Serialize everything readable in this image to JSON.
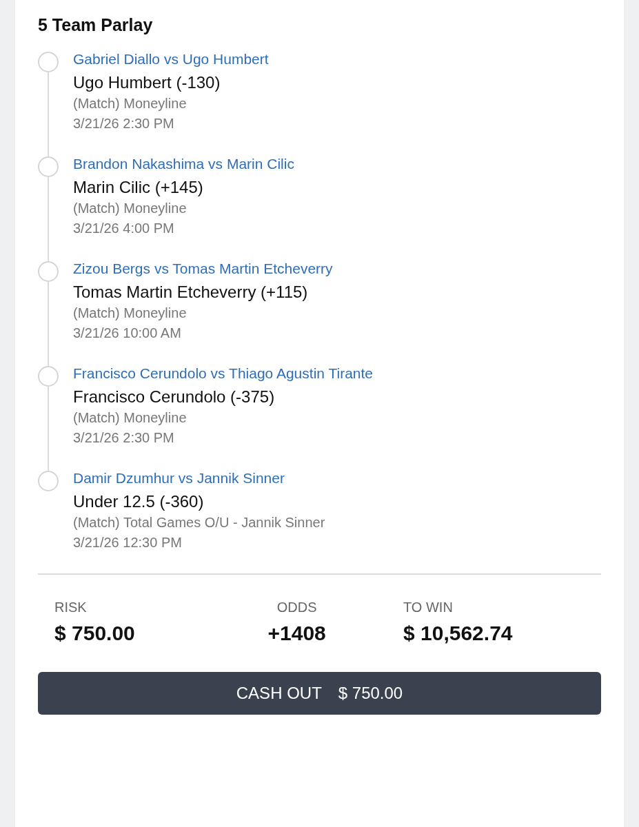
{
  "title": "5 Team Parlay",
  "legs": [
    {
      "matchup": "Gabriel Diallo vs Ugo Humbert",
      "pick": "Ugo Humbert (-130)",
      "market": "(Match) Moneyline",
      "time": "3/21/26 2:30 PM"
    },
    {
      "matchup": "Brandon Nakashima vs Marin Cilic",
      "pick": "Marin Cilic (+145)",
      "market": "(Match) Moneyline",
      "time": "3/21/26 4:00 PM"
    },
    {
      "matchup": "Zizou Bergs vs Tomas Martin Etcheverry",
      "pick": "Tomas Martin Etcheverry (+115)",
      "market": "(Match) Moneyline",
      "time": "3/21/26 10:00 AM"
    },
    {
      "matchup": "Francisco Cerundolo vs Thiago Agustin Tirante",
      "pick": "Francisco Cerundolo (-375)",
      "market": "(Match) Moneyline",
      "time": "3/21/26 2:30 PM"
    },
    {
      "matchup": "Damir Dzumhur vs Jannik Sinner",
      "pick": "Under 12.5 (-360)",
      "market": "(Match) Total Games O/U - Jannik Sinner",
      "time": "3/21/26 12:30 PM"
    }
  ],
  "summary": [
    {
      "label": "RISK",
      "value": "$ 750.00"
    },
    {
      "label": "ODDS",
      "value": "+1408"
    },
    {
      "label": "TO WIN",
      "value": "$ 10,562.74"
    }
  ],
  "cash_out": {
    "label": "CASH OUT",
    "amount": "$ 750.00"
  }
}
